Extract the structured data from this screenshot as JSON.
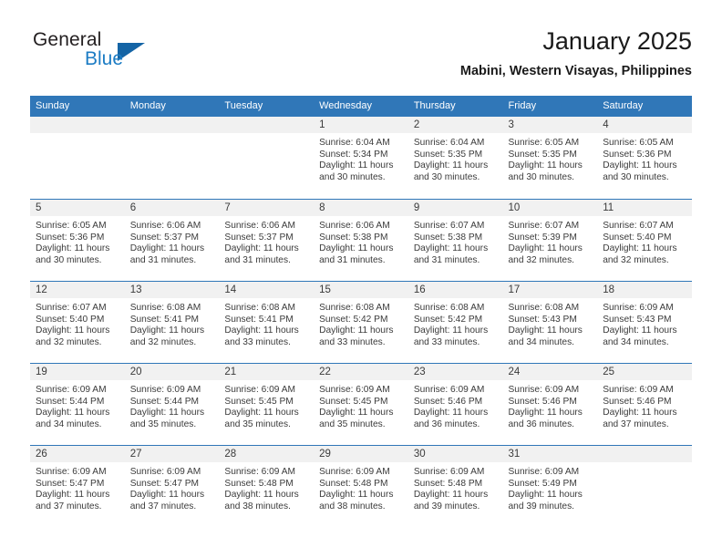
{
  "brand": {
    "name_part1": "General",
    "name_part2": "Blue",
    "triangle_icon": "triangle-icon",
    "accent_color": "#1464a5",
    "blue_text_color": "#1c7cc4"
  },
  "header": {
    "title": "January 2025",
    "subtitle": "Mabini, Western Visayas, Philippines"
  },
  "theme": {
    "header_blue": "#3077b8",
    "daynum_band_gray": "#f1f1f1",
    "text_color": "#3b3b3b"
  },
  "calendar": {
    "weekdays": [
      "Sunday",
      "Monday",
      "Tuesday",
      "Wednesday",
      "Thursday",
      "Friday",
      "Saturday"
    ],
    "weeks": [
      [
        {
          "day": ""
        },
        {
          "day": ""
        },
        {
          "day": ""
        },
        {
          "day": "1",
          "sunrise": "Sunrise: 6:04 AM",
          "sunset": "Sunset: 5:34 PM",
          "daylight_l1": "Daylight: 11 hours",
          "daylight_l2": "and 30 minutes."
        },
        {
          "day": "2",
          "sunrise": "Sunrise: 6:04 AM",
          "sunset": "Sunset: 5:35 PM",
          "daylight_l1": "Daylight: 11 hours",
          "daylight_l2": "and 30 minutes."
        },
        {
          "day": "3",
          "sunrise": "Sunrise: 6:05 AM",
          "sunset": "Sunset: 5:35 PM",
          "daylight_l1": "Daylight: 11 hours",
          "daylight_l2": "and 30 minutes."
        },
        {
          "day": "4",
          "sunrise": "Sunrise: 6:05 AM",
          "sunset": "Sunset: 5:36 PM",
          "daylight_l1": "Daylight: 11 hours",
          "daylight_l2": "and 30 minutes."
        }
      ],
      [
        {
          "day": "5",
          "sunrise": "Sunrise: 6:05 AM",
          "sunset": "Sunset: 5:36 PM",
          "daylight_l1": "Daylight: 11 hours",
          "daylight_l2": "and 30 minutes."
        },
        {
          "day": "6",
          "sunrise": "Sunrise: 6:06 AM",
          "sunset": "Sunset: 5:37 PM",
          "daylight_l1": "Daylight: 11 hours",
          "daylight_l2": "and 31 minutes."
        },
        {
          "day": "7",
          "sunrise": "Sunrise: 6:06 AM",
          "sunset": "Sunset: 5:37 PM",
          "daylight_l1": "Daylight: 11 hours",
          "daylight_l2": "and 31 minutes."
        },
        {
          "day": "8",
          "sunrise": "Sunrise: 6:06 AM",
          "sunset": "Sunset: 5:38 PM",
          "daylight_l1": "Daylight: 11 hours",
          "daylight_l2": "and 31 minutes."
        },
        {
          "day": "9",
          "sunrise": "Sunrise: 6:07 AM",
          "sunset": "Sunset: 5:38 PM",
          "daylight_l1": "Daylight: 11 hours",
          "daylight_l2": "and 31 minutes."
        },
        {
          "day": "10",
          "sunrise": "Sunrise: 6:07 AM",
          "sunset": "Sunset: 5:39 PM",
          "daylight_l1": "Daylight: 11 hours",
          "daylight_l2": "and 32 minutes."
        },
        {
          "day": "11",
          "sunrise": "Sunrise: 6:07 AM",
          "sunset": "Sunset: 5:40 PM",
          "daylight_l1": "Daylight: 11 hours",
          "daylight_l2": "and 32 minutes."
        }
      ],
      [
        {
          "day": "12",
          "sunrise": "Sunrise: 6:07 AM",
          "sunset": "Sunset: 5:40 PM",
          "daylight_l1": "Daylight: 11 hours",
          "daylight_l2": "and 32 minutes."
        },
        {
          "day": "13",
          "sunrise": "Sunrise: 6:08 AM",
          "sunset": "Sunset: 5:41 PM",
          "daylight_l1": "Daylight: 11 hours",
          "daylight_l2": "and 32 minutes."
        },
        {
          "day": "14",
          "sunrise": "Sunrise: 6:08 AM",
          "sunset": "Sunset: 5:41 PM",
          "daylight_l1": "Daylight: 11 hours",
          "daylight_l2": "and 33 minutes."
        },
        {
          "day": "15",
          "sunrise": "Sunrise: 6:08 AM",
          "sunset": "Sunset: 5:42 PM",
          "daylight_l1": "Daylight: 11 hours",
          "daylight_l2": "and 33 minutes."
        },
        {
          "day": "16",
          "sunrise": "Sunrise: 6:08 AM",
          "sunset": "Sunset: 5:42 PM",
          "daylight_l1": "Daylight: 11 hours",
          "daylight_l2": "and 33 minutes."
        },
        {
          "day": "17",
          "sunrise": "Sunrise: 6:08 AM",
          "sunset": "Sunset: 5:43 PM",
          "daylight_l1": "Daylight: 11 hours",
          "daylight_l2": "and 34 minutes."
        },
        {
          "day": "18",
          "sunrise": "Sunrise: 6:09 AM",
          "sunset": "Sunset: 5:43 PM",
          "daylight_l1": "Daylight: 11 hours",
          "daylight_l2": "and 34 minutes."
        }
      ],
      [
        {
          "day": "19",
          "sunrise": "Sunrise: 6:09 AM",
          "sunset": "Sunset: 5:44 PM",
          "daylight_l1": "Daylight: 11 hours",
          "daylight_l2": "and 34 minutes."
        },
        {
          "day": "20",
          "sunrise": "Sunrise: 6:09 AM",
          "sunset": "Sunset: 5:44 PM",
          "daylight_l1": "Daylight: 11 hours",
          "daylight_l2": "and 35 minutes."
        },
        {
          "day": "21",
          "sunrise": "Sunrise: 6:09 AM",
          "sunset": "Sunset: 5:45 PM",
          "daylight_l1": "Daylight: 11 hours",
          "daylight_l2": "and 35 minutes."
        },
        {
          "day": "22",
          "sunrise": "Sunrise: 6:09 AM",
          "sunset": "Sunset: 5:45 PM",
          "daylight_l1": "Daylight: 11 hours",
          "daylight_l2": "and 35 minutes."
        },
        {
          "day": "23",
          "sunrise": "Sunrise: 6:09 AM",
          "sunset": "Sunset: 5:46 PM",
          "daylight_l1": "Daylight: 11 hours",
          "daylight_l2": "and 36 minutes."
        },
        {
          "day": "24",
          "sunrise": "Sunrise: 6:09 AM",
          "sunset": "Sunset: 5:46 PM",
          "daylight_l1": "Daylight: 11 hours",
          "daylight_l2": "and 36 minutes."
        },
        {
          "day": "25",
          "sunrise": "Sunrise: 6:09 AM",
          "sunset": "Sunset: 5:46 PM",
          "daylight_l1": "Daylight: 11 hours",
          "daylight_l2": "and 37 minutes."
        }
      ],
      [
        {
          "day": "26",
          "sunrise": "Sunrise: 6:09 AM",
          "sunset": "Sunset: 5:47 PM",
          "daylight_l1": "Daylight: 11 hours",
          "daylight_l2": "and 37 minutes."
        },
        {
          "day": "27",
          "sunrise": "Sunrise: 6:09 AM",
          "sunset": "Sunset: 5:47 PM",
          "daylight_l1": "Daylight: 11 hours",
          "daylight_l2": "and 37 minutes."
        },
        {
          "day": "28",
          "sunrise": "Sunrise: 6:09 AM",
          "sunset": "Sunset: 5:48 PM",
          "daylight_l1": "Daylight: 11 hours",
          "daylight_l2": "and 38 minutes."
        },
        {
          "day": "29",
          "sunrise": "Sunrise: 6:09 AM",
          "sunset": "Sunset: 5:48 PM",
          "daylight_l1": "Daylight: 11 hours",
          "daylight_l2": "and 38 minutes."
        },
        {
          "day": "30",
          "sunrise": "Sunrise: 6:09 AM",
          "sunset": "Sunset: 5:48 PM",
          "daylight_l1": "Daylight: 11 hours",
          "daylight_l2": "and 39 minutes."
        },
        {
          "day": "31",
          "sunrise": "Sunrise: 6:09 AM",
          "sunset": "Sunset: 5:49 PM",
          "daylight_l1": "Daylight: 11 hours",
          "daylight_l2": "and 39 minutes."
        },
        {
          "day": ""
        }
      ]
    ]
  }
}
